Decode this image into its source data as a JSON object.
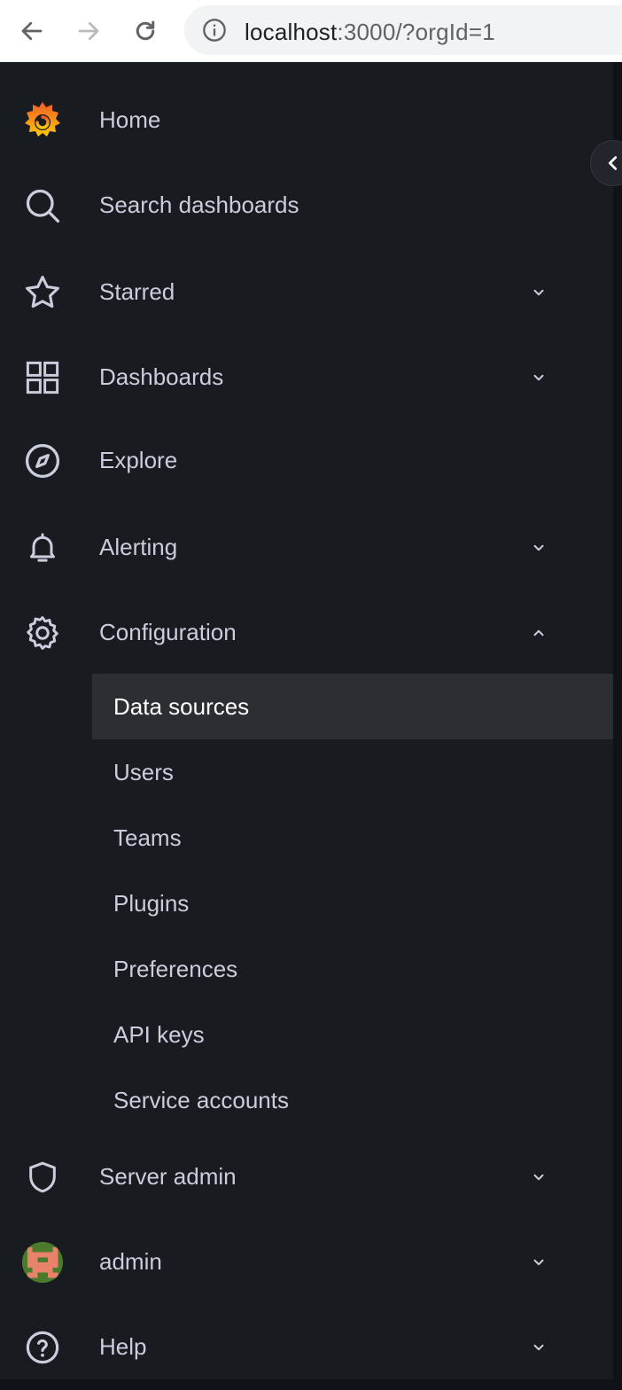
{
  "browser": {
    "url_host": "localhost",
    "url_rest": ":3000/?orgId=1"
  },
  "sidebar": {
    "items": [
      {
        "label": "Home"
      },
      {
        "label": "Search dashboards"
      },
      {
        "label": "Starred"
      },
      {
        "label": "Dashboards"
      },
      {
        "label": "Explore"
      },
      {
        "label": "Alerting"
      },
      {
        "label": "Configuration"
      },
      {
        "label": "Server admin"
      },
      {
        "label": "admin"
      },
      {
        "label": "Help"
      }
    ],
    "configuration_children": [
      {
        "label": "Data sources",
        "active": true
      },
      {
        "label": "Users"
      },
      {
        "label": "Teams"
      },
      {
        "label": "Plugins"
      },
      {
        "label": "Preferences"
      },
      {
        "label": "API keys"
      },
      {
        "label": "Service accounts"
      }
    ]
  },
  "colors": {
    "sidebar_bg": "#181b1f",
    "text": "#ccccdc",
    "active_bg": "#2d2e34"
  }
}
